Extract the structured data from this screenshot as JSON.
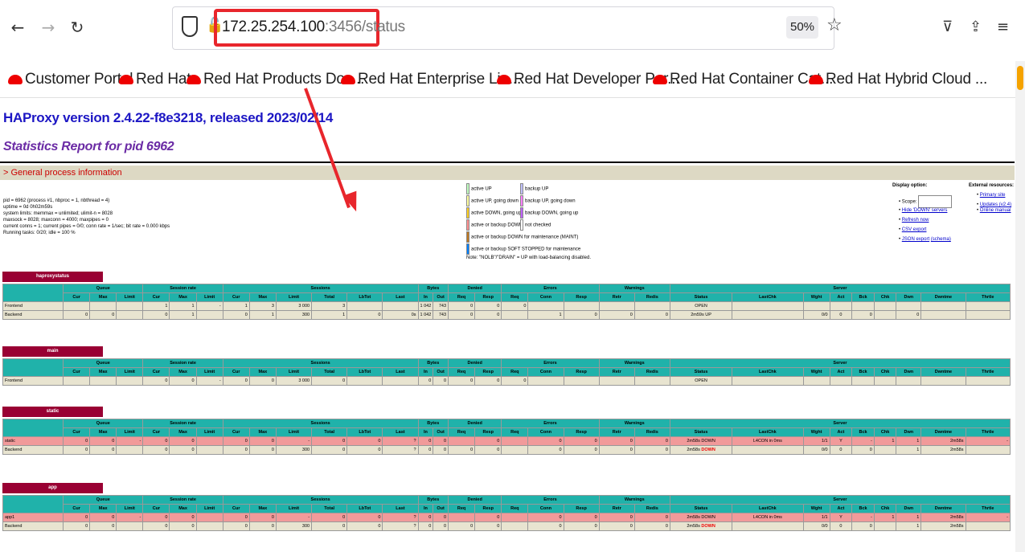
{
  "browser": {
    "url_host": "172.25.254.100",
    "url_rest": ":3456/status",
    "zoom": "50%",
    "bookmarks": [
      "Customer Portal",
      "Red Hat",
      "Red Hat Products Doc...",
      "Red Hat Enterprise Lin...",
      "Red Hat Developer Por...",
      "Red Hat Container Cat...",
      "Red Hat Hybrid Cloud ..."
    ]
  },
  "page": {
    "title": "HAProxy version 2.4.22-f8e3218, released 2023/02/14",
    "subtitle": "Statistics Report for pid 6962",
    "section": "> General process information"
  },
  "process": {
    "pid": "pid = 6962 (process #1, nbproc = 1, nbthread = 4)",
    "uptime": "uptime = 0d 0h02m59s",
    "limits": "system limits: memmax = unlimited; ulimit-n = 8028",
    "maxsock": "maxsock = 8028; maxconn = 4000; maxpipes = 0",
    "conns": "current conns = 1; current pipes = 0/0; conn rate = 1/sec; bit rate = 0.000 kbps",
    "tasks": "Running tasks: 0/20; idle = 100 %"
  },
  "legend": {
    "active_up": "active UP",
    "active_going_down": "active UP, going down",
    "active_going_up": "active DOWN, going up",
    "active_down": "active or backup DOWN",
    "maint": "active or backup DOWN for maintenance (MAINT)",
    "soft_stopped": "active or backup SOFT STOPPED for maintenance",
    "backup_up": "backup UP",
    "backup_going_down": "backup UP, going down",
    "backup_going_up": "backup DOWN, going up",
    "not_checked": "not checked",
    "note": "Note: \"NOLB\"/\"DRAIN\" = UP with load-balancing disabled."
  },
  "display": {
    "title": "Display option:",
    "scope": "Scope:",
    "hide_down": "Hide 'DOWN' servers",
    "refresh": "Refresh now",
    "csv": "CSV export",
    "json": "JSON export",
    "schema": "(schema)"
  },
  "external": {
    "title": "External resources:",
    "primary": "Primary site",
    "updates": "Updates (v2.4)",
    "manual": "Online manual"
  },
  "headers": {
    "groups": [
      "Queue",
      "Session rate",
      "Sessions",
      "Bytes",
      "Denied",
      "Errors",
      "Warnings",
      "Server"
    ],
    "cols": [
      "Cur",
      "Max",
      "Limit",
      "Cur",
      "Max",
      "Limit",
      "Cur",
      "Max",
      "Limit",
      "Total",
      "LbTot",
      "Last",
      "In",
      "Out",
      "Req",
      "Resp",
      "Req",
      "Conn",
      "Resp",
      "Retr",
      "Redis",
      "Status",
      "LastChk",
      "Wght",
      "Act",
      "Bck",
      "Chk",
      "Dwn",
      "Dwntme",
      "Thrtle"
    ]
  },
  "proxies": [
    {
      "name": "haproxystatus",
      "rows": [
        {
          "kind": "front",
          "cells": [
            "Frontend",
            "",
            "",
            "",
            "1",
            "1",
            "-",
            "1",
            "3",
            "3 000",
            "3",
            "",
            "",
            "1 042",
            "743",
            "0",
            "0",
            "0",
            "",
            "",
            "",
            "",
            "OPEN",
            "",
            "",
            "",
            "",
            "",
            "",
            "",
            ""
          ]
        },
        {
          "kind": "back",
          "cells": [
            "Backend",
            "0",
            "0",
            "",
            "0",
            "1",
            "",
            "0",
            "1",
            "300",
            "1",
            "0",
            "0s",
            "1 042",
            "743",
            "0",
            "0",
            "",
            "1",
            "0",
            "0",
            "0",
            "2m59s UP",
            "",
            "0/0",
            "0",
            "0",
            "",
            "0",
            "",
            ""
          ]
        }
      ]
    },
    {
      "name": "main",
      "rows": [
        {
          "kind": "front",
          "cells": [
            "Frontend",
            "",
            "",
            "",
            "0",
            "0",
            "-",
            "0",
            "0",
            "3 000",
            "0",
            "",
            "",
            "0",
            "0",
            "0",
            "0",
            "0",
            "",
            "",
            "",
            "",
            "OPEN",
            "",
            "",
            "",
            "",
            "",
            "",
            "",
            ""
          ]
        }
      ]
    },
    {
      "name": "static",
      "rows": [
        {
          "kind": "down",
          "cells": [
            "static",
            "0",
            "0",
            "-",
            "0",
            "0",
            "",
            "0",
            "0",
            "-",
            "0",
            "0",
            "?",
            "0",
            "0",
            "",
            "0",
            "",
            "0",
            "0",
            "0",
            "0",
            "2m58s DOWN",
            "L4CON in 0ms",
            "1/1",
            "Y",
            "-",
            "1",
            "1",
            "2m58s",
            "-"
          ]
        },
        {
          "kind": "back",
          "cells": [
            "Backend",
            "0",
            "0",
            "",
            "0",
            "0",
            "",
            "0",
            "0",
            "300",
            "0",
            "0",
            "?",
            "0",
            "0",
            "0",
            "0",
            "",
            "0",
            "0",
            "0",
            "0",
            "2m58s DOWN",
            "",
            "0/0",
            "0",
            "0",
            "",
            "1",
            "2m58s",
            ""
          ]
        }
      ]
    },
    {
      "name": "app",
      "rows": [
        {
          "kind": "down",
          "cells": [
            "app1",
            "0",
            "0",
            "-",
            "0",
            "0",
            "",
            "0",
            "0",
            "-",
            "0",
            "0",
            "?",
            "0",
            "0",
            "",
            "0",
            "",
            "0",
            "0",
            "0",
            "0",
            "2m58s DOWN",
            "L4CON in 0ms",
            "1/1",
            "Y",
            "-",
            "1",
            "1",
            "2m58s",
            "-"
          ]
        },
        {
          "kind": "back",
          "cells": [
            "Backend",
            "0",
            "0",
            "",
            "0",
            "0",
            "",
            "0",
            "0",
            "300",
            "0",
            "0",
            "?",
            "0",
            "0",
            "0",
            "0",
            "",
            "0",
            "0",
            "0",
            "0",
            "2m58s DOWN",
            "",
            "0/0",
            "0",
            "0",
            "",
            "1",
            "2m58s",
            ""
          ]
        }
      ]
    }
  ]
}
